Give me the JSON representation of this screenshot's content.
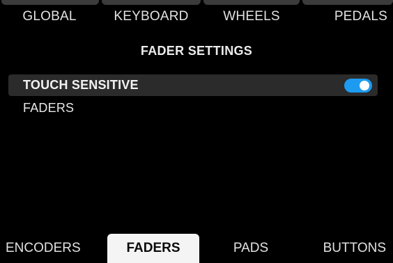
{
  "top_tabs": [
    {
      "label": "GLOBAL"
    },
    {
      "label": "KEYBOARD"
    },
    {
      "label": "WHEELS"
    },
    {
      "label": "PEDALS"
    }
  ],
  "section_title": "FADER SETTINGS",
  "settings": [
    {
      "label": "TOUCH SENSITIVE",
      "toggle_on": true,
      "toggle_color": "#1d9bf0"
    }
  ],
  "sub_label": "FADERS",
  "bottom_tabs": [
    {
      "label": "ENCODERS",
      "active": false
    },
    {
      "label": "FADERS",
      "active": true
    },
    {
      "label": "PADS",
      "active": false
    },
    {
      "label": "BUTTONS",
      "active": false
    }
  ],
  "colors": {
    "background": "#000000",
    "row_highlight": "#2b2b2b",
    "active_tab": "#f4f4f4",
    "accent": "#1d9bf0"
  }
}
